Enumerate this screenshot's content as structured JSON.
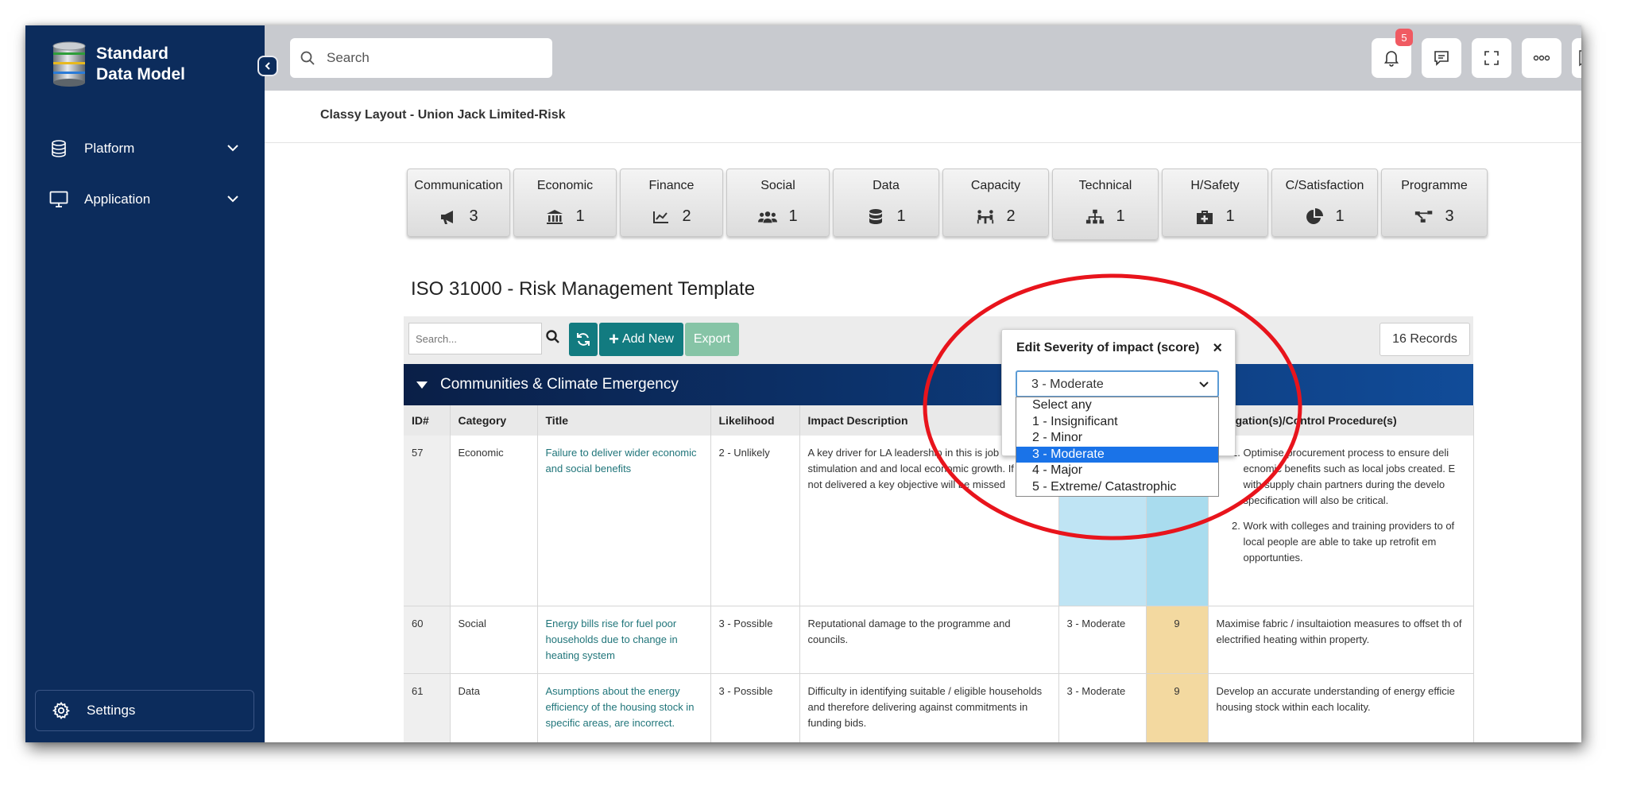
{
  "app": {
    "brand_line1": "Standard",
    "brand_line2": "Data Model"
  },
  "sidebar": {
    "items": [
      {
        "label": "Platform",
        "icon": "database-icon"
      },
      {
        "label": "Application",
        "icon": "monitor-icon"
      }
    ],
    "settings_label": "Settings"
  },
  "topbar": {
    "search_placeholder": "Search",
    "notification_count": "5"
  },
  "breadcrumb": "Classy Layout - Union Jack Limited-Risk",
  "categories": [
    {
      "label": "Communication",
      "count": "3",
      "icon": "megaphone-icon"
    },
    {
      "label": "Economic",
      "count": "1",
      "icon": "bank-icon"
    },
    {
      "label": "Finance",
      "count": "2",
      "icon": "line-chart-icon"
    },
    {
      "label": "Social",
      "count": "1",
      "icon": "users-icon"
    },
    {
      "label": "Data",
      "count": "1",
      "icon": "database-icon"
    },
    {
      "label": "Capacity",
      "count": "2",
      "icon": "people-table-icon"
    },
    {
      "label": "Technical",
      "count": "1",
      "icon": "sitemap-icon"
    },
    {
      "label": "H/Safety",
      "count": "1",
      "icon": "first-aid-icon"
    },
    {
      "label": "C/Satisfaction",
      "count": "1",
      "icon": "pie-chart-icon"
    },
    {
      "label": "Programme",
      "count": "3",
      "icon": "project-diagram-icon"
    }
  ],
  "page_title": "ISO 31000 - Risk Management Template",
  "toolbar": {
    "search_placeholder": "Search...",
    "add_label": "Add New",
    "export_label": "Export",
    "records_label": "16 Records"
  },
  "group": {
    "title": "Communities & Climate Emergency"
  },
  "table": {
    "headers": {
      "id": "ID#",
      "category": "Category",
      "title": "Title",
      "likelihood": "Likelihood",
      "impact": "Impact Description",
      "severity": "",
      "score": "",
      "mitigation": "Mitigation(s)/Control Procedure(s)"
    },
    "rows": [
      {
        "id": "57",
        "category": "Economic",
        "title": "Failure to deliver wider economic and social benefits",
        "likelihood": "2 - Unlikely",
        "impact": "A key driver for LA leadership in this is job stimulation and and local economic growth. If this is not delivered a key objective will be missed",
        "severity": "",
        "score": "",
        "mitigation_items": [
          "Optimise procurement process to ensure deli ecnomic benefits such as local jobs created. E with supply chain partners during the develo specification will also be critical.",
          "Work with colleges and training providers to of local people are able to take up retrofit em opportunties."
        ]
      },
      {
        "id": "60",
        "category": "Social",
        "title": "Energy bills rise for fuel poor households due to change in heating system",
        "likelihood": "3 - Possible",
        "impact": "Reputational damage to the programme and councils.",
        "severity": "3 - Moderate",
        "score": "9",
        "mitigation": "Maximise fabric / insultaiotion  measures to offset th of electrified heating within property."
      },
      {
        "id": "61",
        "category": "Data",
        "title": "Asumptions about the energy efficiency of the housing stock in specific areas, are incorrect.",
        "likelihood": "3 - Possible",
        "impact": "Difficulty in identifying suitable / eligible households and therefore delivering against commitments in funding bids.",
        "severity": "3 - Moderate",
        "score": "9",
        "mitigation": "Develop an accurate understanding of energy efficie housing stock within each locality."
      }
    ]
  },
  "popup": {
    "title": "Edit Severity of impact (score)",
    "close": "×",
    "selected": "3 - Moderate",
    "options": [
      "Select any",
      "1 - Insignificant",
      "2 - Minor",
      "3 - Moderate",
      "4 - Major",
      "5 - Extreme/ Catastrophic"
    ]
  },
  "colors": {
    "sidebar": "#0c2c5c",
    "accent_teal": "#127b80",
    "export_green": "#86c4a6",
    "annotation": "#e8141c",
    "selection_blue": "#1a73e8"
  }
}
